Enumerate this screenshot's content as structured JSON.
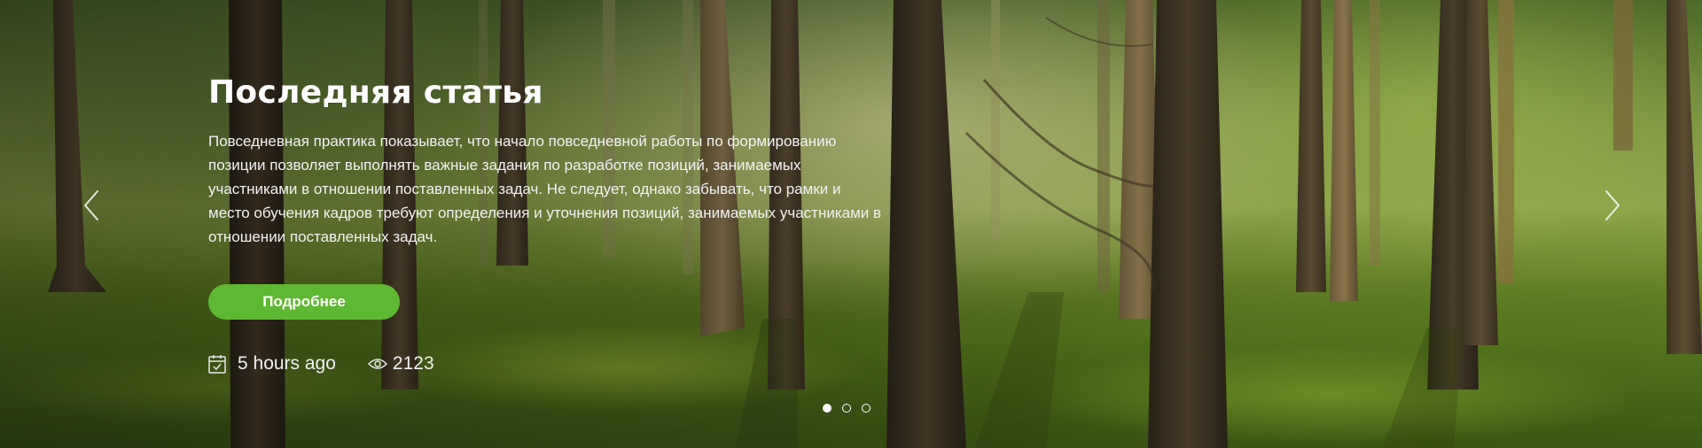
{
  "slide": {
    "title": "Последняя статья",
    "excerpt": "Повседневная практика показывает, что начало повседневной работы по формированию позиции позволяет выполнять важные задания по разработке позиций, занимаемых участниками в отношении поставленных задач. Не следует, однако забывать, что рамки и место обучения кадров требуют определения и уточнения позиций, занимаемых участниками в отношении поставленных задач.",
    "button_label": "Подробнее",
    "date_text": "5 hours ago",
    "views": "2123",
    "date_icon": "calendar-icon",
    "views_icon": "eye-icon"
  },
  "pagination": {
    "total": 3,
    "active_index": 0
  },
  "navigation": {
    "prev_icon": "chevron-left-icon",
    "next_icon": "chevron-right-icon"
  },
  "colors": {
    "accent": "#5fb832",
    "text": "#ffffff"
  }
}
